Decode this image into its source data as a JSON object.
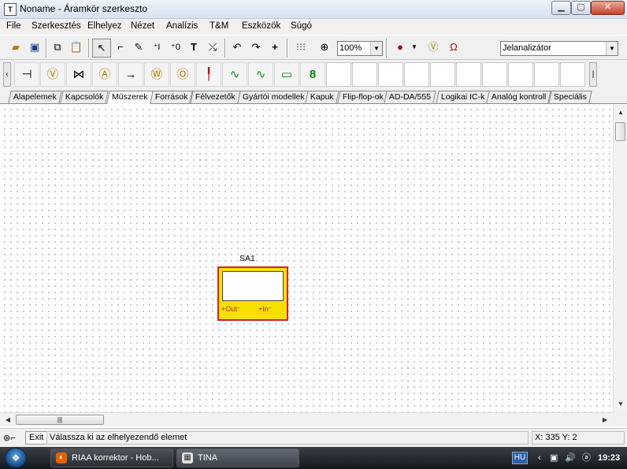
{
  "window": {
    "title": "Noname - Áramkör szerkeszto",
    "app_icon": "tina-app-icon",
    "controls": {
      "minimize": "minimize-icon",
      "maximize": "maximize-icon",
      "close": "close-icon"
    }
  },
  "menu": {
    "items": [
      "File",
      "Szerkesztés",
      "Elhelyez",
      "Nézet",
      "Analízis",
      "T&M",
      "Eszközök",
      "Súgó"
    ]
  },
  "toolbar": {
    "zoom_value": "100%",
    "analyzer_select": "Jelanalizátor",
    "buttons": [
      {
        "name": "open-icon",
        "glyph": "📂"
      },
      {
        "name": "save-icon",
        "glyph": "💾"
      },
      {
        "name": "copy-icon",
        "glyph": "⧉"
      },
      {
        "name": "paste-icon",
        "glyph": "📋"
      },
      {
        "name": "select-arrow-icon",
        "glyph": "↖"
      },
      {
        "name": "wire-icon",
        "glyph": "⌐"
      },
      {
        "name": "pen-icon",
        "glyph": "✎"
      },
      {
        "name": "input-marker-icon",
        "glyph": "⁺I"
      },
      {
        "name": "output-marker-icon",
        "glyph": "⁺0"
      },
      {
        "name": "text-icon",
        "glyph": "T"
      },
      {
        "name": "delete-wire-icon",
        "glyph": "⤯"
      },
      {
        "name": "undo-icon",
        "glyph": "↶"
      },
      {
        "name": "redo-icon",
        "glyph": "↷"
      },
      {
        "name": "crosshair-icon",
        "glyph": "+"
      },
      {
        "name": "grid-icon",
        "glyph": "⋯"
      },
      {
        "name": "zoom-icon",
        "glyph": "🔍"
      },
      {
        "name": "dc-analysis-icon",
        "glyph": "●"
      },
      {
        "name": "meter-icon",
        "glyph": "Ⓥ"
      },
      {
        "name": "resistor-probe-icon",
        "glyph": "Ω"
      }
    ]
  },
  "components": [
    {
      "name": "switch-component-icon",
      "glyph": "⊣"
    },
    {
      "name": "voltmeter-component-icon",
      "glyph": "Ⓥ"
    },
    {
      "name": "probe-component-icon",
      "glyph": "⋈"
    },
    {
      "name": "ammeter-component-icon",
      "glyph": "Ⓐ"
    },
    {
      "name": "wire-component-icon",
      "glyph": "→"
    },
    {
      "name": "wattmeter-component-icon",
      "glyph": "Ⓦ"
    },
    {
      "name": "ohmmeter-component-icon",
      "glyph": "Ⓞ"
    },
    {
      "name": "pin-component-icon",
      "glyph": "╿"
    },
    {
      "name": "oscilloscope-component-icon",
      "glyph": "∿"
    },
    {
      "name": "signal-analyzer-component-icon",
      "glyph": "∿"
    },
    {
      "name": "counter-component-icon",
      "glyph": "▭"
    },
    {
      "name": "display-component-icon",
      "glyph": "8"
    }
  ],
  "tabs": [
    {
      "label": "Alapelemek"
    },
    {
      "label": "Kapcsolók"
    },
    {
      "label": "Műszerek",
      "active": true
    },
    {
      "label": "Források"
    },
    {
      "label": "Félvezetők"
    },
    {
      "label": "Gyártói modellek"
    },
    {
      "label": "Kapuk"
    },
    {
      "label": "Flip-flop-ok"
    },
    {
      "label": "AD-DA/555"
    },
    {
      "label": "Logikai IC-k"
    },
    {
      "label": "Analóg kontroll"
    },
    {
      "label": "Speciális"
    }
  ],
  "canvas": {
    "component": {
      "label": "SA1",
      "port_out": "Out",
      "port_in": "In"
    }
  },
  "status": {
    "exit_label": "Exit",
    "message": "Válassza ki az elhelyezendő elemet",
    "coords": "X: 335 Y: 2"
  },
  "taskbar": {
    "tasks": [
      {
        "label": "RIAA korrektor - Hob..."
      },
      {
        "label": "TINA"
      }
    ],
    "language": "HU",
    "time": "19:23"
  }
}
